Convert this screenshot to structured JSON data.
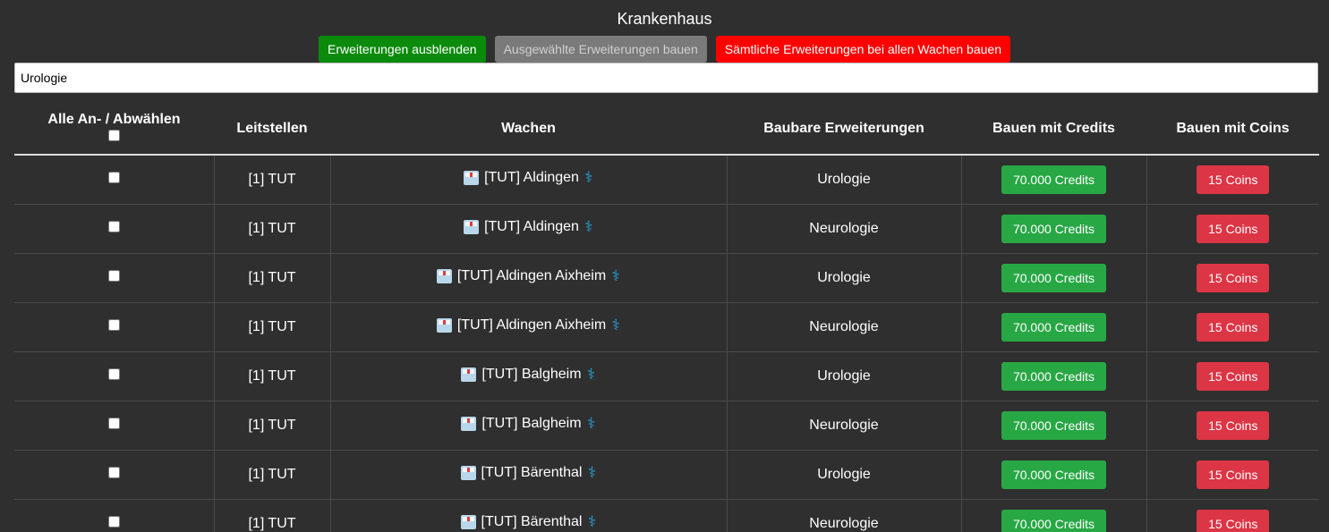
{
  "title": "Krankenhaus",
  "buttons": {
    "hide": "Erweiterungen ausblenden",
    "build_selected": "Ausgewählte Erweiterungen bauen",
    "build_all": "Sämtliche Erweiterungen bei allen Wachen bauen"
  },
  "search": {
    "value": "Urologie"
  },
  "table": {
    "headers": {
      "select": "Alle An- / Abwählen",
      "dispatch": "Leitstellen",
      "stations": "Wachen",
      "extensions": "Baubare Erweiterungen",
      "credits": "Bauen mit Credits",
      "coins": "Bauen mit Coins"
    },
    "rows": [
      {
        "dispatch": "[1] TUT",
        "station": "[TUT] Aldingen",
        "extension": "Urologie",
        "credits": "70.000 Credits",
        "coins": "15 Coins"
      },
      {
        "dispatch": "[1] TUT",
        "station": "[TUT] Aldingen",
        "extension": "Neurologie",
        "credits": "70.000 Credits",
        "coins": "15 Coins"
      },
      {
        "dispatch": "[1] TUT",
        "station": "[TUT] Aldingen Aixheim",
        "extension": "Urologie",
        "credits": "70.000 Credits",
        "coins": "15 Coins"
      },
      {
        "dispatch": "[1] TUT",
        "station": "[TUT] Aldingen Aixheim",
        "extension": "Neurologie",
        "credits": "70.000 Credits",
        "coins": "15 Coins"
      },
      {
        "dispatch": "[1] TUT",
        "station": "[TUT] Balgheim",
        "extension": "Urologie",
        "credits": "70.000 Credits",
        "coins": "15 Coins"
      },
      {
        "dispatch": "[1] TUT",
        "station": "[TUT] Balgheim",
        "extension": "Neurologie",
        "credits": "70.000 Credits",
        "coins": "15 Coins"
      },
      {
        "dispatch": "[1] TUT",
        "station": "[TUT] Bärenthal",
        "extension": "Urologie",
        "credits": "70.000 Credits",
        "coins": "15 Coins"
      },
      {
        "dispatch": "[1] TUT",
        "station": "[TUT] Bärenthal",
        "extension": "Neurologie",
        "credits": "70.000 Credits",
        "coins": "15 Coins"
      }
    ]
  },
  "icons": {
    "station": "hospital-building-icon",
    "staff": "staff-caduceus-icon"
  },
  "colors": {
    "background": "#2f2f2f",
    "hide_button": "#0b8a0b",
    "build_selected_button": "#7a7a7a",
    "build_all_button": "#ff0000",
    "credits_button": "#28a745",
    "coins_button": "#dc3545",
    "staff_icon": "#27a6e0"
  }
}
